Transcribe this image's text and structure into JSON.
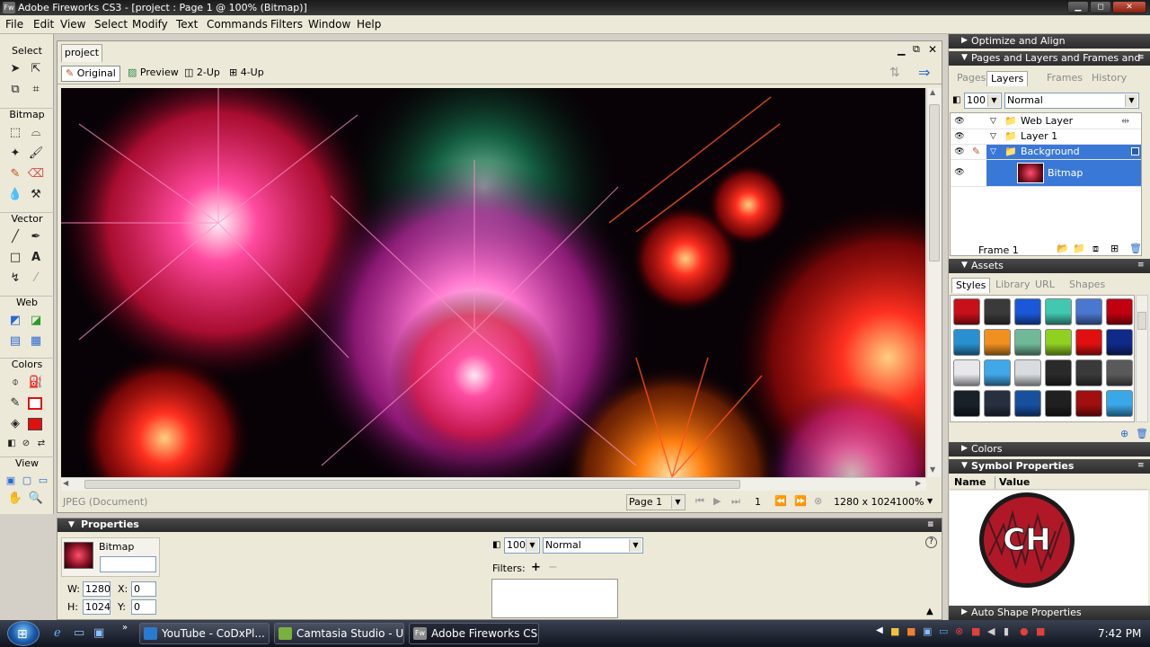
{
  "titlebar": {
    "title": "Adobe Fireworks CS3 - [project : Page 1 @ 100% (Bitmap)]",
    "icon": "Fw"
  },
  "menu": [
    "File",
    "Edit",
    "View",
    "Select",
    "Modify",
    "Text",
    "Commands",
    "Filters",
    "Window",
    "Help"
  ],
  "tools": {
    "sections": [
      "Select",
      "Bitmap",
      "Vector",
      "Web",
      "Colors",
      "View"
    ],
    "stroke_color": "#000000",
    "fill_color": "#e01010"
  },
  "document": {
    "tab": "project",
    "views": [
      "Original",
      "Preview",
      "2-Up",
      "4-Up"
    ],
    "active_view": "Original",
    "status_type": "JPEG (Document)",
    "page": "Page 1",
    "frame_num": "1",
    "size": "1280 x 1024",
    "zoom": "100%"
  },
  "properties": {
    "header": "Properties",
    "object_type": "Bitmap",
    "name_value": "",
    "w_label": "W:",
    "w": "1280",
    "h_label": "H:",
    "h": "1024",
    "x_label": "X:",
    "x": "0",
    "y_label": "Y:",
    "y": "0",
    "opacity": "100",
    "blend": "Normal",
    "filters_label": "Filters:"
  },
  "right": {
    "optimize": "Optimize and Align",
    "pages_layers": "Pages and Layers and Frames and ...",
    "tabs": [
      "Pages",
      "Layers",
      "Frames",
      "History"
    ],
    "active_tab": "Layers",
    "opacity": "100",
    "blend": "Normal",
    "layers": [
      "Web Layer",
      "Layer 1",
      "Background"
    ],
    "sublayer": "Bitmap",
    "frame": "Frame 1",
    "assets": "Assets",
    "asset_tabs": [
      "Styles",
      "Library",
      "URL",
      "Shapes"
    ],
    "active_asset_tab": "Styles",
    "colors": "Colors",
    "symbol": "Symbol Properties",
    "sym_cols": [
      "Name",
      "Value"
    ],
    "logo_text": "CH",
    "auto_shape": "Auto Shape Properties"
  },
  "styles": [
    "#c8101a",
    "#3a3a3a",
    "#1a58d8",
    "#40c8b0",
    "#4a78d0",
    "#c00010",
    "#2890d0",
    "#f09020",
    "#70b898",
    "#90d020",
    "#e01010",
    "#102a8a",
    "#e8e8ec",
    "#40a8e8",
    "#d8dce0",
    "#2a2a2a",
    "#3a3a3a",
    "#5a5a5a",
    "#182028",
    "#283040",
    "#1850a0",
    "#202020",
    "#a01010",
    "#38a8e8"
  ],
  "taskbar": {
    "tasks": [
      "YouTube - CoDxPl...",
      "Camtasia Studio - U...",
      "Adobe Fireworks CS..."
    ],
    "time": "7:42 PM"
  }
}
